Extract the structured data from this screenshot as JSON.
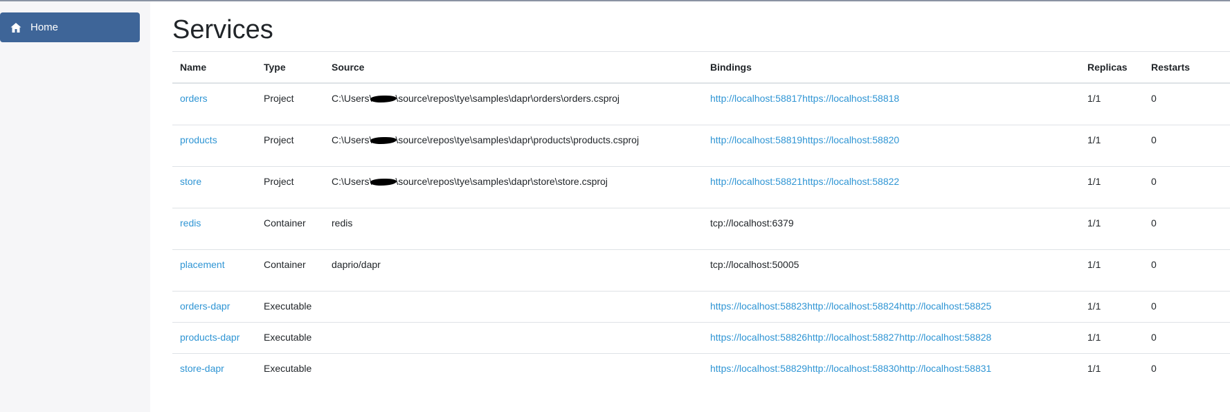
{
  "sidebar": {
    "home_label": "Home",
    "home_icon": "home-icon",
    "accent_color": "#3e6598"
  },
  "main": {
    "title": "Services"
  },
  "table": {
    "headers": {
      "name": "Name",
      "type": "Type",
      "source": "Source",
      "bindings": "Bindings",
      "replicas": "Replicas",
      "restarts": "Restarts"
    },
    "rows": [
      {
        "name": "orders",
        "type": "Project",
        "source_prefix": "C:\\Users\\",
        "source_suffix": "\\source\\repos\\tye\\samples\\dapr\\orders\\orders.csproj",
        "bindings": [
          "http://localhost:58817",
          "https://localhost:58818"
        ],
        "replicas": "1/1",
        "restarts": "0"
      },
      {
        "name": "products",
        "type": "Project",
        "source_prefix": "C:\\Users\\",
        "source_suffix": "\\source\\repos\\tye\\samples\\dapr\\products\\products.csproj",
        "bindings": [
          "http://localhost:58819",
          "https://localhost:58820"
        ],
        "replicas": "1/1",
        "restarts": "0"
      },
      {
        "name": "store",
        "type": "Project",
        "source_prefix": "C:\\Users\\",
        "source_suffix": "\\source\\repos\\tye\\samples\\dapr\\store\\store.csproj",
        "bindings": [
          "http://localhost:58821",
          "https://localhost:58822"
        ],
        "replicas": "1/1",
        "restarts": "0"
      },
      {
        "name": "redis",
        "type": "Container",
        "source": "redis",
        "binding_text": "tcp://localhost:6379",
        "replicas": "1/1",
        "restarts": "0"
      },
      {
        "name": "placement",
        "type": "Container",
        "source": "daprio/dapr",
        "binding_text": "tcp://localhost:50005",
        "replicas": "1/1",
        "restarts": "0"
      },
      {
        "name": "orders-dapr",
        "type": "Executable",
        "source": "",
        "bindings": [
          "https://localhost:58823",
          "http://localhost:58824",
          "http://localhost:58825"
        ],
        "replicas": "1/1",
        "restarts": "0"
      },
      {
        "name": "products-dapr",
        "type": "Executable",
        "source": "",
        "bindings": [
          "https://localhost:58826",
          "http://localhost:58827",
          "http://localhost:58828"
        ],
        "replicas": "1/1",
        "restarts": "0"
      },
      {
        "name": "store-dapr",
        "type": "Executable",
        "source": "",
        "bindings": [
          "https://localhost:58829",
          "http://localhost:58830",
          "http://localhost:58831"
        ],
        "replicas": "1/1",
        "restarts": "0"
      }
    ],
    "link_color": "#2f95d4"
  }
}
